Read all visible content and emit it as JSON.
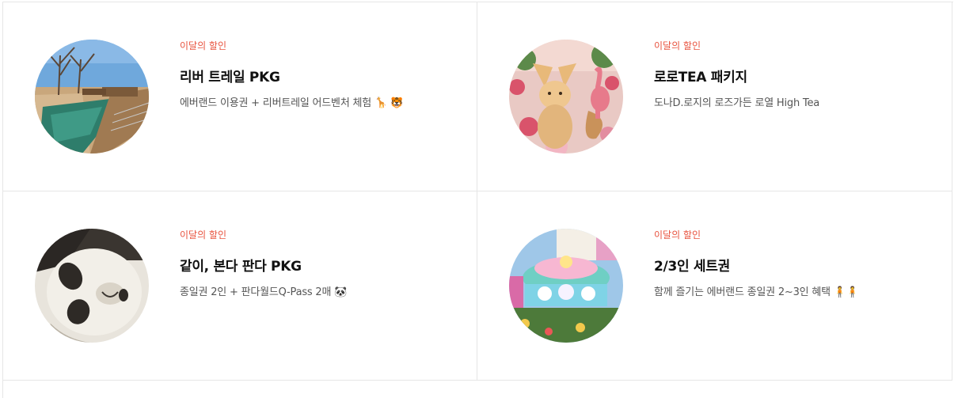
{
  "cards": [
    {
      "badge": "이달의 할인",
      "title": "리버 트레일 PKG",
      "description": "에버랜드 이용권 + 리버트레일 어드벤처 체험",
      "emoji": "🦒 🐯",
      "image": "river-trail-photo"
    },
    {
      "badge": "이달의 할인",
      "title": "로로TEA 패키지",
      "description": "도나D.로지의 로즈가든 로열 High Tea",
      "emoji": "",
      "image": "fox-flamingo-illustration"
    },
    {
      "badge": "이달의 할인",
      "title": "같이, 본다 판다 PKG",
      "description": "종일권 2인 + 판다월드Q-Pass 2매",
      "emoji": "🐼",
      "image": "panda-photo"
    },
    {
      "badge": "이달의 할인",
      "title": "2/3인 세트권",
      "description": "함께 즐기는 에버랜드 종일권 2~3인 혜택",
      "emoji": "🧍🧍",
      "image": "amusement-ride-photo"
    }
  ],
  "colors": {
    "badge": "#e8533f",
    "title": "#111111",
    "description": "#555555",
    "border": "#e6e6e6"
  }
}
